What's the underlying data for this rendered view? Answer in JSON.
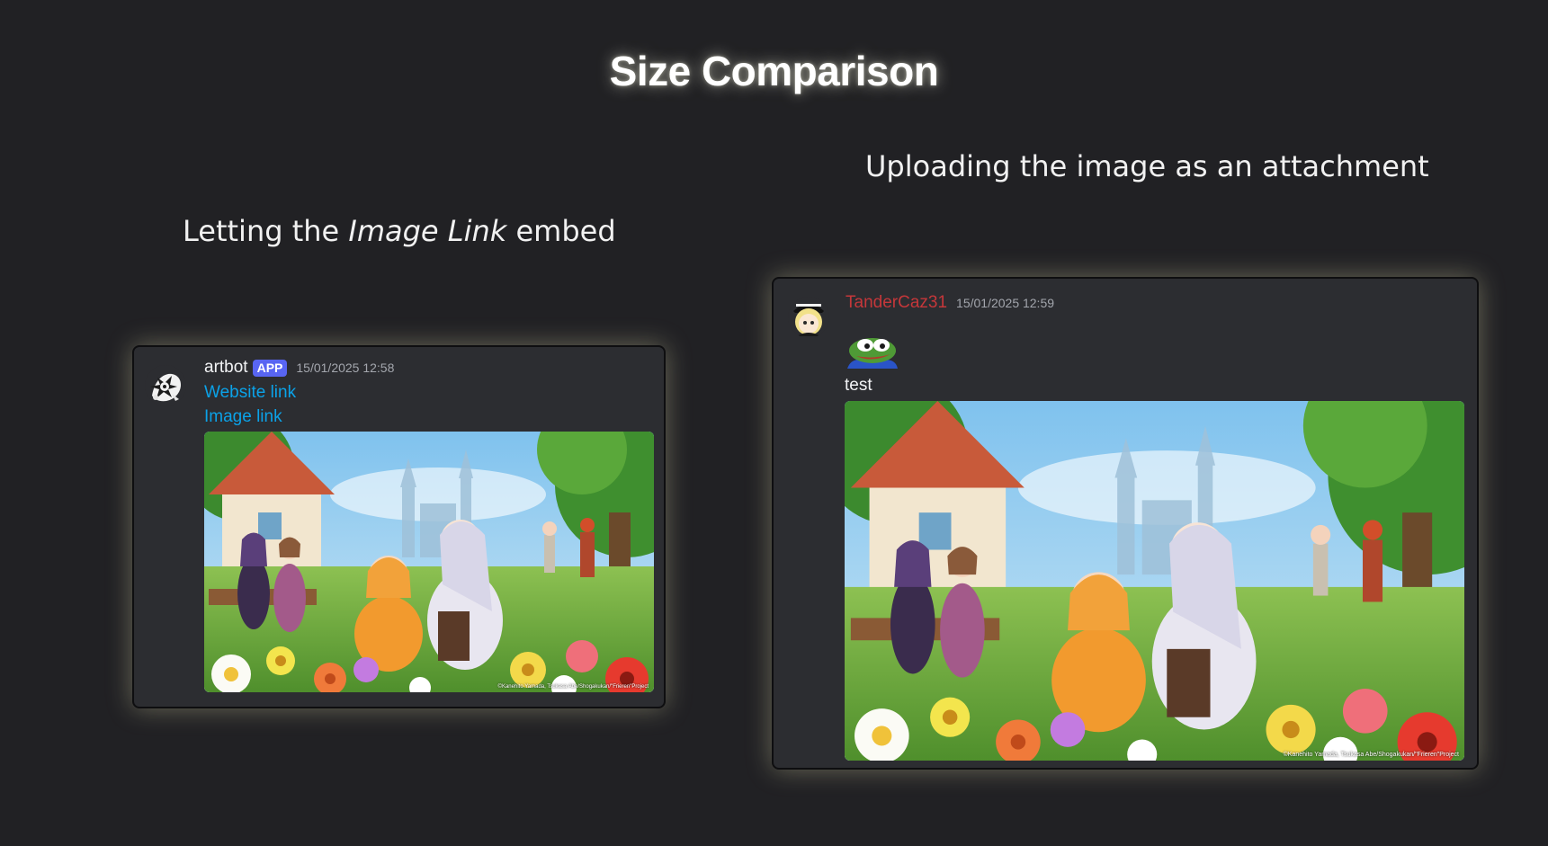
{
  "title": "Size Comparison",
  "captions": {
    "left_prefix": "Letting the ",
    "left_emphasis": "Image Link",
    "left_suffix": " embed",
    "right": "Uploading the image as an attachment"
  },
  "left_message": {
    "username": "artbot",
    "badge": "APP",
    "timestamp": "15/01/2025 12:58",
    "links": [
      "Website link",
      "Image link"
    ],
    "image_credit": "©Kanehito Yamada, Tsukasa Abe/Shogakukan/\"Frieren\"Project",
    "avatar_icon": "artbot-avatar-icon"
  },
  "right_message": {
    "username": "TanderCaz31",
    "timestamp": "15/01/2025 12:59",
    "text": "test",
    "emoji_icon": "pepe-frog-emoji-icon",
    "image_credit": "©Kanehito Yamada, Tsukasa Abe/Shogakukan/\"Frieren\"Project",
    "avatar_icon": "user-avatar-icon"
  },
  "colors": {
    "background": "#212124",
    "card": "#2c2d31",
    "link": "#0ba2e8",
    "app_badge": "#5865f2",
    "username_red": "#c5373a",
    "card_glow": "#e1deaa"
  }
}
